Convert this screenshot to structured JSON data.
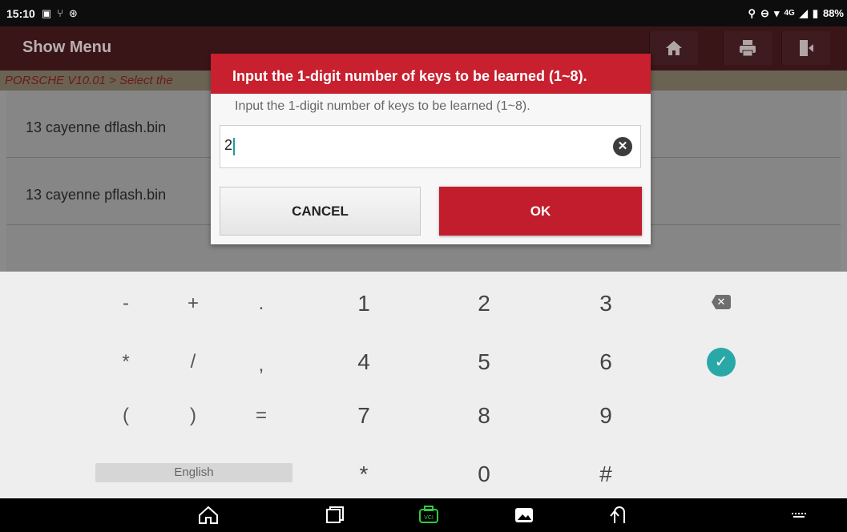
{
  "status_bar": {
    "time": "15:10",
    "battery": "88%",
    "network": "4G"
  },
  "app_bar": {
    "title": "Show Menu"
  },
  "breadcrumb": "PORSCHE V10.01 > Select the",
  "list_items": [
    "13 cayenne dflash.bin",
    "13 cayenne pflash.bin"
  ],
  "dialog": {
    "title": "Input the 1-digit number of keys to be learned (1~8).",
    "message": "Input the 1-digit number of keys to be learned (1~8).",
    "input_value": "2",
    "cancel_label": "CANCEL",
    "ok_label": "OK"
  },
  "keyboard": {
    "rows": [
      [
        "-",
        "+",
        ".",
        "1",
        "2",
        "3"
      ],
      [
        "*",
        "/",
        ",",
        "4",
        "5",
        "6"
      ],
      [
        "(",
        ")",
        "=",
        "7",
        "8",
        "9"
      ],
      [
        "*",
        "0",
        "#"
      ]
    ],
    "language": "English"
  },
  "colors": {
    "accent": "#c8202f",
    "app_bar": "#3a1518",
    "teal": "#2aa8a8"
  }
}
